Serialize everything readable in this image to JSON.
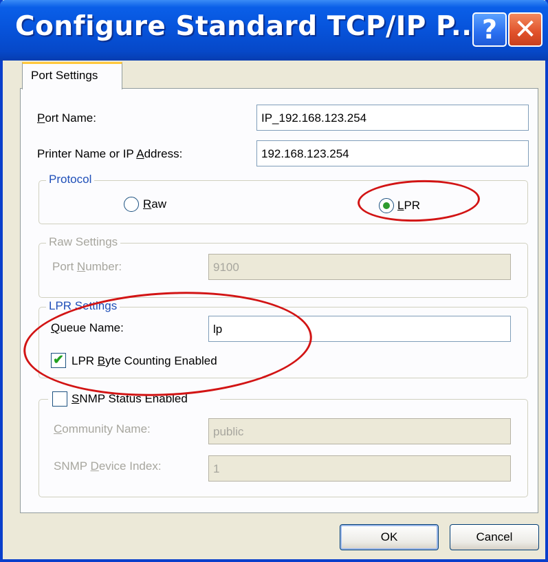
{
  "window": {
    "title": "Configure Standard TCP/IP P...",
    "help_label": "?",
    "close_label": "✕"
  },
  "tabs": [
    {
      "label": "Port Settings"
    }
  ],
  "port_name": {
    "label_u": "P",
    "label_rest": "ort Name:",
    "value": "IP_192.168.123.254"
  },
  "printer_address": {
    "label_pre": "Printer Name or IP ",
    "label_u": "A",
    "label_rest": "ddress:",
    "value": "192.168.123.254"
  },
  "protocol": {
    "title": "Protocol",
    "raw": {
      "label_u": "R",
      "label_rest": "aw",
      "selected": false
    },
    "lpr": {
      "label_u": "L",
      "label_rest": "PR",
      "selected": true
    }
  },
  "raw_settings": {
    "title": "Raw Settings",
    "port_number": {
      "label_pre": "Port ",
      "label_u": "N",
      "label_rest": "umber:",
      "value": "9100"
    }
  },
  "lpr_settings": {
    "title": "LPR Settings",
    "queue_name": {
      "label_u": "Q",
      "label_rest": "ueue Name:",
      "value": "lp"
    },
    "byte_counting": {
      "label_pre": "LPR ",
      "label_u": "B",
      "label_rest": "yte Counting Enabled",
      "checked": true
    }
  },
  "snmp": {
    "status_label_u": "S",
    "status_label_rest": "NMP Status Enabled",
    "enabled": false,
    "community_name": {
      "label_u": "C",
      "label_rest": "ommunity Name:",
      "value": "public"
    },
    "device_index": {
      "label_pre": "SNMP ",
      "label_u": "D",
      "label_rest": "evice Index:",
      "value": "1"
    }
  },
  "buttons": {
    "ok": "OK",
    "cancel": "Cancel"
  },
  "colors": {
    "title_bar": "#0754DC",
    "face": "#ECE9D8",
    "annotation": "#D21414",
    "group_title": "#1F4FB8",
    "disabled_text": "#A7A69E"
  },
  "icons": {
    "help": "help-icon",
    "close": "close-icon",
    "check": "checkmark-icon"
  }
}
